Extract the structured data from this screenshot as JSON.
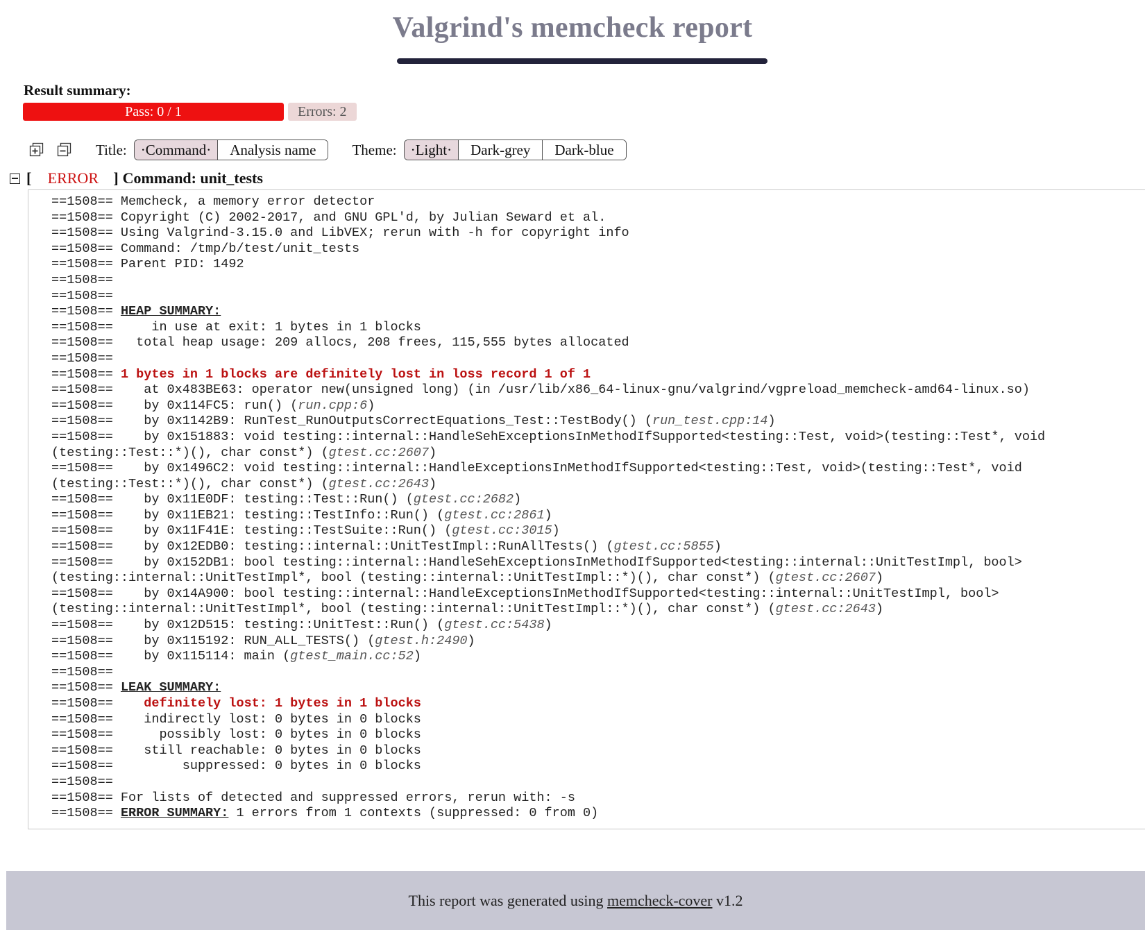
{
  "page_title": "Valgrind's memcheck report",
  "summary": {
    "label": "Result summary:",
    "pass_text": "Pass: 0 / 1",
    "pass_fraction": 0,
    "errors_text": "Errors: 2"
  },
  "toolbar": {
    "expand_icon": "expand-all-icon",
    "collapse_icon": "collapse-all-icon",
    "title_label": "Title:",
    "title_options": [
      {
        "label": "Command",
        "active": true
      },
      {
        "label": "Analysis name",
        "active": false
      }
    ],
    "theme_label": "Theme:",
    "theme_options": [
      {
        "label": "Light",
        "active": true
      },
      {
        "label": "Dark-grey",
        "active": false
      },
      {
        "label": "Dark-blue",
        "active": false
      }
    ]
  },
  "section": {
    "bracket_open": "[",
    "status": "ERROR",
    "bracket_close": "]",
    "heading": "Command: unit_tests"
  },
  "log": {
    "prefix": "==1508==",
    "lines": [
      [
        [
          "",
          " Memcheck, a memory error detector"
        ]
      ],
      [
        [
          "",
          " Copyright (C) 2002-2017, and GNU GPL'd, by Julian Seward et al."
        ]
      ],
      [
        [
          "",
          " Using Valgrind-3.15.0 and LibVEX; rerun with -h for copyright info"
        ]
      ],
      [
        [
          "",
          " Command: /tmp/b/test/unit_tests"
        ]
      ],
      [
        [
          "",
          " Parent PID: 1492"
        ]
      ],
      [],
      [],
      [
        [
          "",
          " "
        ],
        [
          "hdr",
          "HEAP SUMMARY:"
        ]
      ],
      [
        [
          "",
          "     in use at exit: 1 bytes in 1 blocks"
        ]
      ],
      [
        [
          "",
          "   total heap usage: 209 allocs, 208 frees, 115,555 bytes allocated"
        ]
      ],
      [],
      [
        [
          "",
          " "
        ],
        [
          "err",
          "1 bytes in 1 blocks are definitely lost in loss record 1 of 1"
        ]
      ],
      [
        [
          "",
          "    at 0x483BE63: operator new(unsigned long) (in /usr/lib/x86_64-linux-gnu/valgrind/vgpreload_memcheck-amd64-linux.so)"
        ]
      ],
      [
        [
          "",
          "    by 0x114FC5: run() ("
        ],
        [
          "loc",
          "run.cpp:6"
        ],
        [
          "",
          ")"
        ]
      ],
      [
        [
          "",
          "    by 0x1142B9: RunTest_RunOutputsCorrectEquations_Test::TestBody() ("
        ],
        [
          "loc",
          "run_test.cpp:14"
        ],
        [
          "",
          ")"
        ]
      ],
      [
        [
          "",
          "    by 0x151883: void testing::internal::HandleSehExceptionsInMethodIfSupported<testing::Test, void>(testing::Test*, void (testing::Test::*)(), char const*) ("
        ],
        [
          "loc",
          "gtest.cc:2607"
        ],
        [
          "",
          ")"
        ]
      ],
      [
        [
          "",
          "    by 0x1496C2: void testing::internal::HandleExceptionsInMethodIfSupported<testing::Test, void>(testing::Test*, void (testing::Test::*)(), char const*) ("
        ],
        [
          "loc",
          "gtest.cc:2643"
        ],
        [
          "",
          ")"
        ]
      ],
      [
        [
          "",
          "    by 0x11E0DF: testing::Test::Run() ("
        ],
        [
          "loc",
          "gtest.cc:2682"
        ],
        [
          "",
          ")"
        ]
      ],
      [
        [
          "",
          "    by 0x11EB21: testing::TestInfo::Run() ("
        ],
        [
          "loc",
          "gtest.cc:2861"
        ],
        [
          "",
          ")"
        ]
      ],
      [
        [
          "",
          "    by 0x11F41E: testing::TestSuite::Run() ("
        ],
        [
          "loc",
          "gtest.cc:3015"
        ],
        [
          "",
          ")"
        ]
      ],
      [
        [
          "",
          "    by 0x12EDB0: testing::internal::UnitTestImpl::RunAllTests() ("
        ],
        [
          "loc",
          "gtest.cc:5855"
        ],
        [
          "",
          ")"
        ]
      ],
      [
        [
          "",
          "    by 0x152DB1: bool testing::internal::HandleSehExceptionsInMethodIfSupported<testing::internal::UnitTestImpl, bool>(testing::internal::UnitTestImpl*, bool (testing::internal::UnitTestImpl::*)(), char const*) ("
        ],
        [
          "loc",
          "gtest.cc:2607"
        ],
        [
          "",
          ")"
        ]
      ],
      [
        [
          "",
          "    by 0x14A900: bool testing::internal::HandleExceptionsInMethodIfSupported<testing::internal::UnitTestImpl, bool>(testing::internal::UnitTestImpl*, bool (testing::internal::UnitTestImpl::*)(), char const*) ("
        ],
        [
          "loc",
          "gtest.cc:2643"
        ],
        [
          "",
          ")"
        ]
      ],
      [
        [
          "",
          "    by 0x12D515: testing::UnitTest::Run() ("
        ],
        [
          "loc",
          "gtest.cc:5438"
        ],
        [
          "",
          ")"
        ]
      ],
      [
        [
          "",
          "    by 0x115192: RUN_ALL_TESTS() ("
        ],
        [
          "loc",
          "gtest.h:2490"
        ],
        [
          "",
          ")"
        ]
      ],
      [
        [
          "",
          "    by 0x115114: main ("
        ],
        [
          "loc",
          "gtest_main.cc:52"
        ],
        [
          "",
          ")"
        ]
      ],
      [],
      [
        [
          "",
          " "
        ],
        [
          "hdr",
          "LEAK SUMMARY:"
        ]
      ],
      [
        [
          "",
          "    "
        ],
        [
          "err",
          "definitely lost: 1 bytes in 1 blocks"
        ]
      ],
      [
        [
          "",
          "    indirectly lost: 0 bytes in 0 blocks"
        ]
      ],
      [
        [
          "",
          "      possibly lost: 0 bytes in 0 blocks"
        ]
      ],
      [
        [
          "",
          "    still reachable: 0 bytes in 0 blocks"
        ]
      ],
      [
        [
          "",
          "         suppressed: 0 bytes in 0 blocks"
        ]
      ],
      [],
      [
        [
          "",
          " For lists of detected and suppressed errors, rerun with: -s"
        ]
      ],
      [
        [
          "",
          " "
        ],
        [
          "hdr",
          "ERROR SUMMARY:"
        ],
        [
          "",
          " 1 errors from 1 contexts (suppressed: 0 from 0)"
        ]
      ]
    ]
  },
  "footer": {
    "text_before": "This report was generated using ",
    "link_text": "memcheck-cover",
    "text_after": " v1.2"
  }
}
